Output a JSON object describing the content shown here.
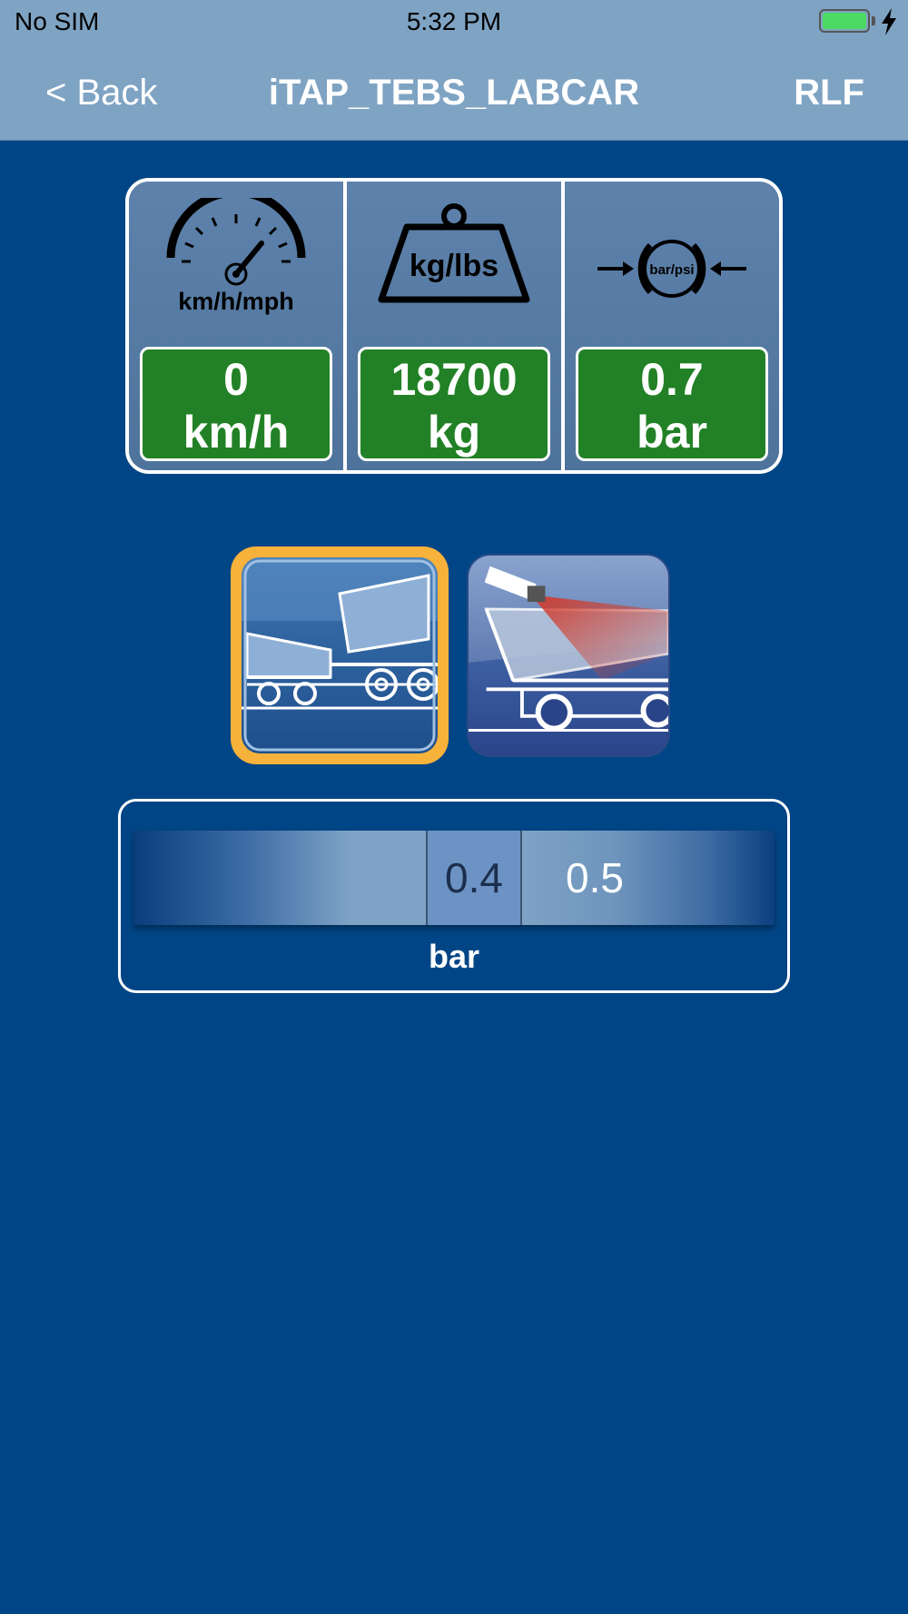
{
  "status_bar": {
    "carrier": "No SIM",
    "time": "5:32 PM",
    "battery_icon": "battery-full-icon",
    "charging_icon": "bolt-icon"
  },
  "nav": {
    "back_label": "< Back",
    "title": "iTAP_TEBS_LABCAR",
    "right_label": "RLF"
  },
  "gauges": [
    {
      "icon": "speedometer-icon",
      "icon_label": "km/h/mph",
      "value": "0",
      "unit": "km/h"
    },
    {
      "icon": "weight-icon",
      "icon_label": "kg/lbs",
      "value": "18700",
      "unit": "kg"
    },
    {
      "icon": "pressure-icon",
      "icon_label": "bar/psi",
      "value": "0.7",
      "unit": "bar"
    }
  ],
  "modes": [
    {
      "name": "tipping-mode",
      "icon": "tipper-truck-icon",
      "selected": true
    },
    {
      "name": "camera-mode",
      "icon": "tipper-camera-icon",
      "selected": false
    }
  ],
  "picker": {
    "values": [
      "0.4",
      "0.5"
    ],
    "selected": "0.4",
    "unit": "bar"
  },
  "colors": {
    "background": "#004585",
    "nav_bar": "#7fa3c3",
    "value_box": "#228126",
    "selection_ring": "#f7b23b",
    "battery": "#4cd964"
  }
}
